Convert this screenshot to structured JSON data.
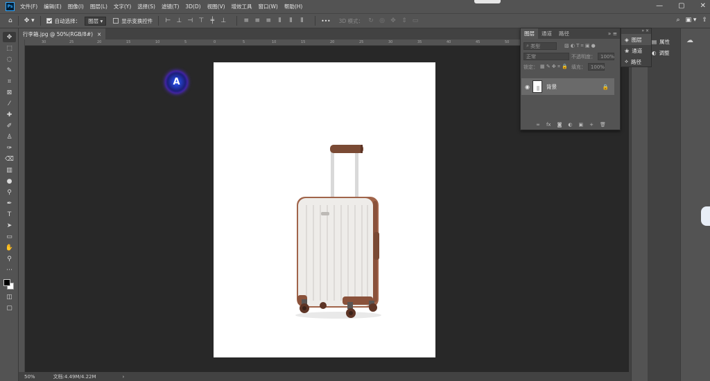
{
  "app": {
    "logo": "Ps"
  },
  "menu": [
    "文件(F)",
    "编辑(E)",
    "图像(I)",
    "图层(L)",
    "文字(Y)",
    "选择(S)",
    "滤镜(T)",
    "3D(D)",
    "视图(V)",
    "增效工具",
    "窗口(W)",
    "帮助(H)"
  ],
  "window_controls": [
    "—",
    "▢",
    "✕"
  ],
  "options": {
    "auto_select_label": "自动选择：",
    "auto_select_value": "图层",
    "show_transform_label": "显示变换控件",
    "mode_3d_label": "3D 模式：",
    "more": "•••"
  },
  "document": {
    "tab_title": "行李箱.jpg @ 50%(RGB/8#)",
    "close": "×",
    "ruler_ticks": [
      "30",
      "25",
      "20",
      "15",
      "10",
      "5",
      "0",
      "5",
      "10",
      "15",
      "20",
      "25",
      "30",
      "35",
      "40",
      "45",
      "50",
      "55"
    ]
  },
  "status": {
    "zoom": "50%",
    "doc_info": "文档:4.49M/4.22M",
    "arrow": "›"
  },
  "layers_panel": {
    "tabs": [
      "图层",
      "通道",
      "路径"
    ],
    "kind_label": "类型",
    "blend_mode": "正常",
    "opacity_label": "不透明度：",
    "opacity_value": "100%",
    "lock_label": "锁定：",
    "fill_label": "填充：",
    "fill_value": "100%",
    "layer_name": "背景",
    "footer_icons": [
      "∞",
      "fx",
      "◙",
      "◐",
      "▣",
      "+",
      "🗑"
    ]
  },
  "mini_panel": {
    "items": [
      "图层",
      "通道",
      "路径"
    ]
  },
  "props_panel": {
    "items": [
      "属性",
      "调整"
    ]
  },
  "plugin_badge": "A",
  "colors": {
    "accent": "#31a8ff",
    "panel": "#535353",
    "dark": "#282828"
  }
}
